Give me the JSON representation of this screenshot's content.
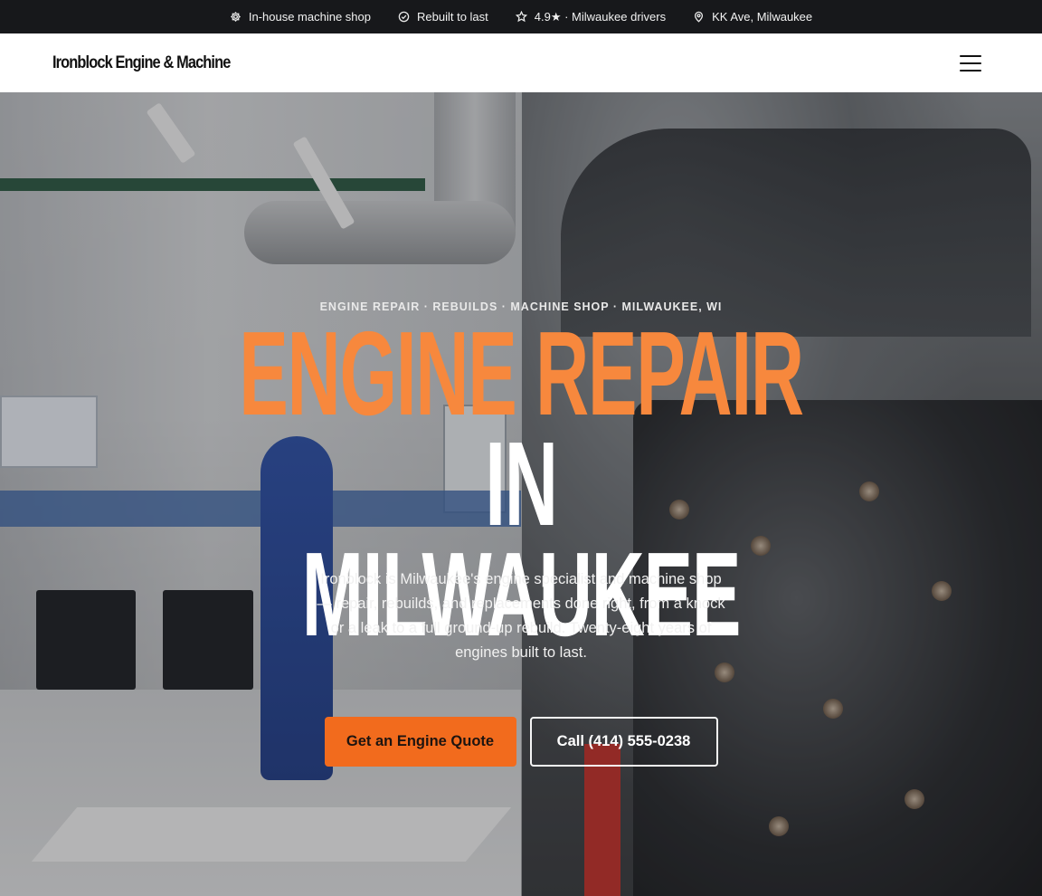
{
  "topbar": {
    "items": [
      {
        "icon": "gear-icon",
        "label": "In-house machine shop"
      },
      {
        "icon": "check-circle-icon",
        "label": "Rebuilt to last"
      },
      {
        "icon": "star-icon",
        "label": "4.9★ · Milwaukee drivers"
      },
      {
        "icon": "map-pin-icon",
        "label": "KK Ave, Milwaukee"
      }
    ]
  },
  "nav": {
    "logo": "Ironblock Engine & Machine",
    "menu_icon": "hamburger-menu-icon"
  },
  "hero": {
    "eyebrow": "ENGINE REPAIR · REBUILDS · MACHINE SHOP · MILWAUKEE, WI",
    "headline_accent": "ENGINE REPAIR",
    "headline_rest": "IN",
    "headline_line2": "MILWAUKEE",
    "lede": "Ironblock is Milwaukee's engine specialist and machine shop — repair, rebuilds, and replacements done right, from a knock or a leak to a full ground-up rebuild. Twenty-eight years of engines built to last.",
    "primary_cta": "Get an Engine Quote",
    "secondary_cta": "Call (414) 555-0238"
  },
  "colors": {
    "accent": "#f7883d",
    "primary_button": "#f26b1d",
    "topbar_bg": "#17181b"
  }
}
